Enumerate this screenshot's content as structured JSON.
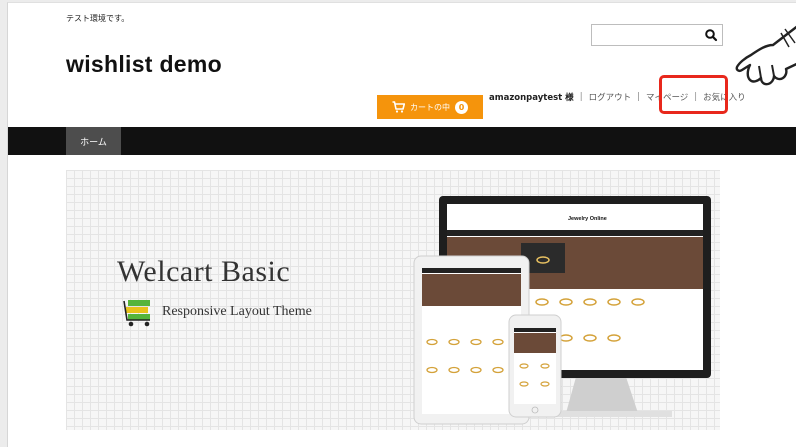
{
  "header": {
    "tagline": "テスト環境です。",
    "site_title": "wishlist demo",
    "search": {
      "value": "",
      "icon": "search-icon"
    }
  },
  "cart": {
    "label": "カートの中",
    "count": "0",
    "icon": "cart-icon"
  },
  "user_nav": {
    "username": "amazonpaytest 様",
    "logout": "ログアウト",
    "mypage": "マイページ",
    "favorites": "お気に入り"
  },
  "colors": {
    "accent": "#f5940c",
    "highlight": "#e8281c",
    "navbar": "#111111"
  },
  "navbar": {
    "items": [
      {
        "label": "ホーム"
      }
    ]
  },
  "banner": {
    "title": "Welcart Basic",
    "subtitle": "Responsive Layout Theme",
    "desktop_site_title": "Jewelry Online"
  }
}
